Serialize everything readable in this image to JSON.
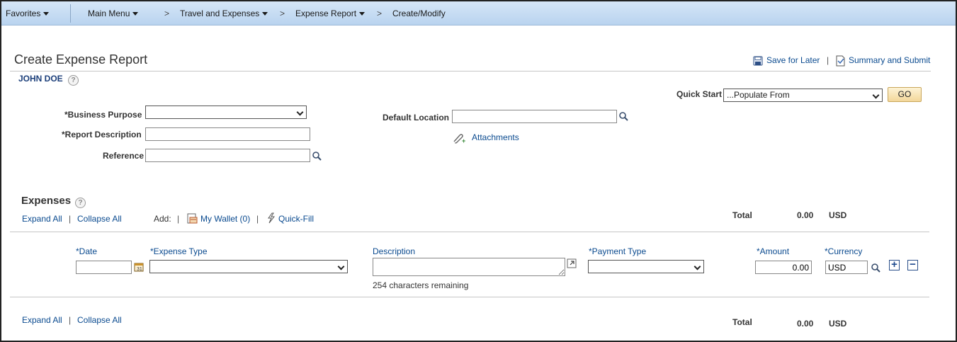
{
  "nav": {
    "favorites": "Favorites",
    "main_menu": "Main Menu",
    "crumb_sep": ">",
    "travel": "Travel and Expenses",
    "expense_report": "Expense Report",
    "create_modify": "Create/Modify"
  },
  "page": {
    "title": "Create Expense Report",
    "save_for_later": "Save for Later",
    "action_sep": "|",
    "summary_submit": "Summary and Submit",
    "employee_name": "JOHN DOE",
    "help_glyph": "?"
  },
  "quick_start": {
    "label": "Quick Start",
    "value": "...Populate From",
    "go_label": "GO"
  },
  "form": {
    "business_purpose_label": "*Business Purpose",
    "business_purpose_value": "",
    "report_description_label": "*Report Description",
    "report_description_value": "",
    "reference_label": "Reference",
    "reference_value": "",
    "default_location_label": "Default Location",
    "default_location_value": "",
    "attachments_label": "Attachments"
  },
  "expenses": {
    "section_title": "Expenses",
    "expand_all": "Expand All",
    "collapse_all": "Collapse All",
    "sep": "|",
    "add_label": "Add:",
    "my_wallet": "My Wallet (0)",
    "quick_fill": "Quick-Fill",
    "total_label": "Total",
    "total_value": "0.00",
    "total_currency": "USD",
    "columns": {
      "date": "*Date",
      "expense_type": "*Expense Type",
      "description": "Description",
      "payment_type": "*Payment Type",
      "amount": "*Amount",
      "currency": "*Currency"
    },
    "row": {
      "date": "",
      "expense_type": "",
      "description": "",
      "chars_remaining": "254 characters remaining",
      "payment_type": "",
      "amount": "0.00",
      "currency": "USD",
      "add_row": "+",
      "remove_row": "−"
    }
  },
  "colors": {
    "nav_bg": "#c7dcf3",
    "link": "#0a4a8f",
    "go_button": "#f3d79a"
  },
  "icons": [
    "caret-down-icon",
    "help-icon",
    "save-icon",
    "summary-icon",
    "magnifier-icon",
    "paperclip-icon",
    "calendar-icon",
    "wallet-icon",
    "quick-fill-icon",
    "expand-text-icon",
    "plus-icon",
    "minus-icon"
  ]
}
